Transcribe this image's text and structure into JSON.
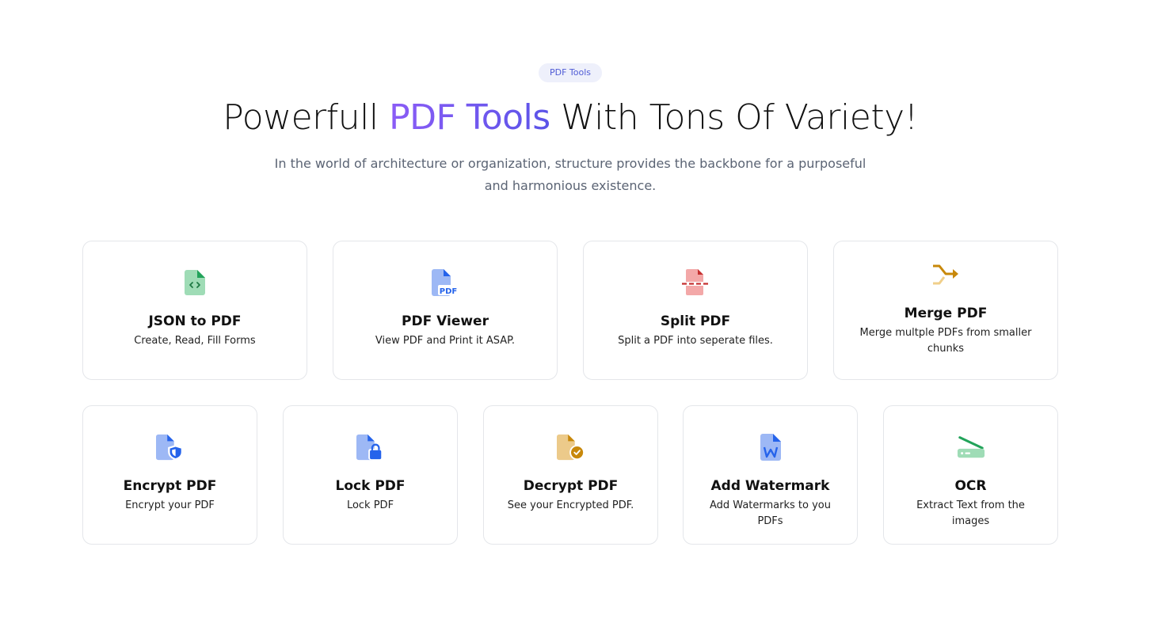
{
  "badge": "PDF Tools",
  "headline": {
    "before": "Powerfull ",
    "accent": "PDF Tools",
    "after": " With Tons Of Variety!"
  },
  "subtitle": "In the world of architecture or organization, structure provides the backbone for a purposeful and harmonious existence.",
  "tools": [
    {
      "title": "JSON to PDF",
      "desc": "Create, Read, Fill Forms",
      "icon": "json-file-icon"
    },
    {
      "title": "PDF Viewer",
      "desc": "View PDF and Print it ASAP.",
      "icon": "pdf-file-icon"
    },
    {
      "title": "Split PDF",
      "desc": "Split a PDF into seperate files.",
      "icon": "split-file-icon"
    },
    {
      "title": "Merge PDF",
      "desc": "Merge multple PDFs from smaller chunks",
      "icon": "merge-arrows-icon"
    },
    {
      "title": "Encrypt PDF",
      "desc": "Encrypt your PDF",
      "icon": "shield-file-icon"
    },
    {
      "title": "Lock PDF",
      "desc": "Lock PDF",
      "icon": "lock-file-icon"
    },
    {
      "title": "Decrypt PDF",
      "desc": "See your Encrypted PDF.",
      "icon": "check-file-icon"
    },
    {
      "title": "Add Watermark",
      "desc": "Add Watermarks to you PDFs",
      "icon": "word-file-icon"
    },
    {
      "title": "OCR",
      "desc": "Extract Text from the images",
      "icon": "scanner-icon"
    }
  ],
  "colors": {
    "accent_start": "#8b5cf6",
    "accent_end": "#5b54e8",
    "green": "#22a35a",
    "blue": "#2563eb",
    "red": "#c53030",
    "gold": "#c8880a"
  }
}
